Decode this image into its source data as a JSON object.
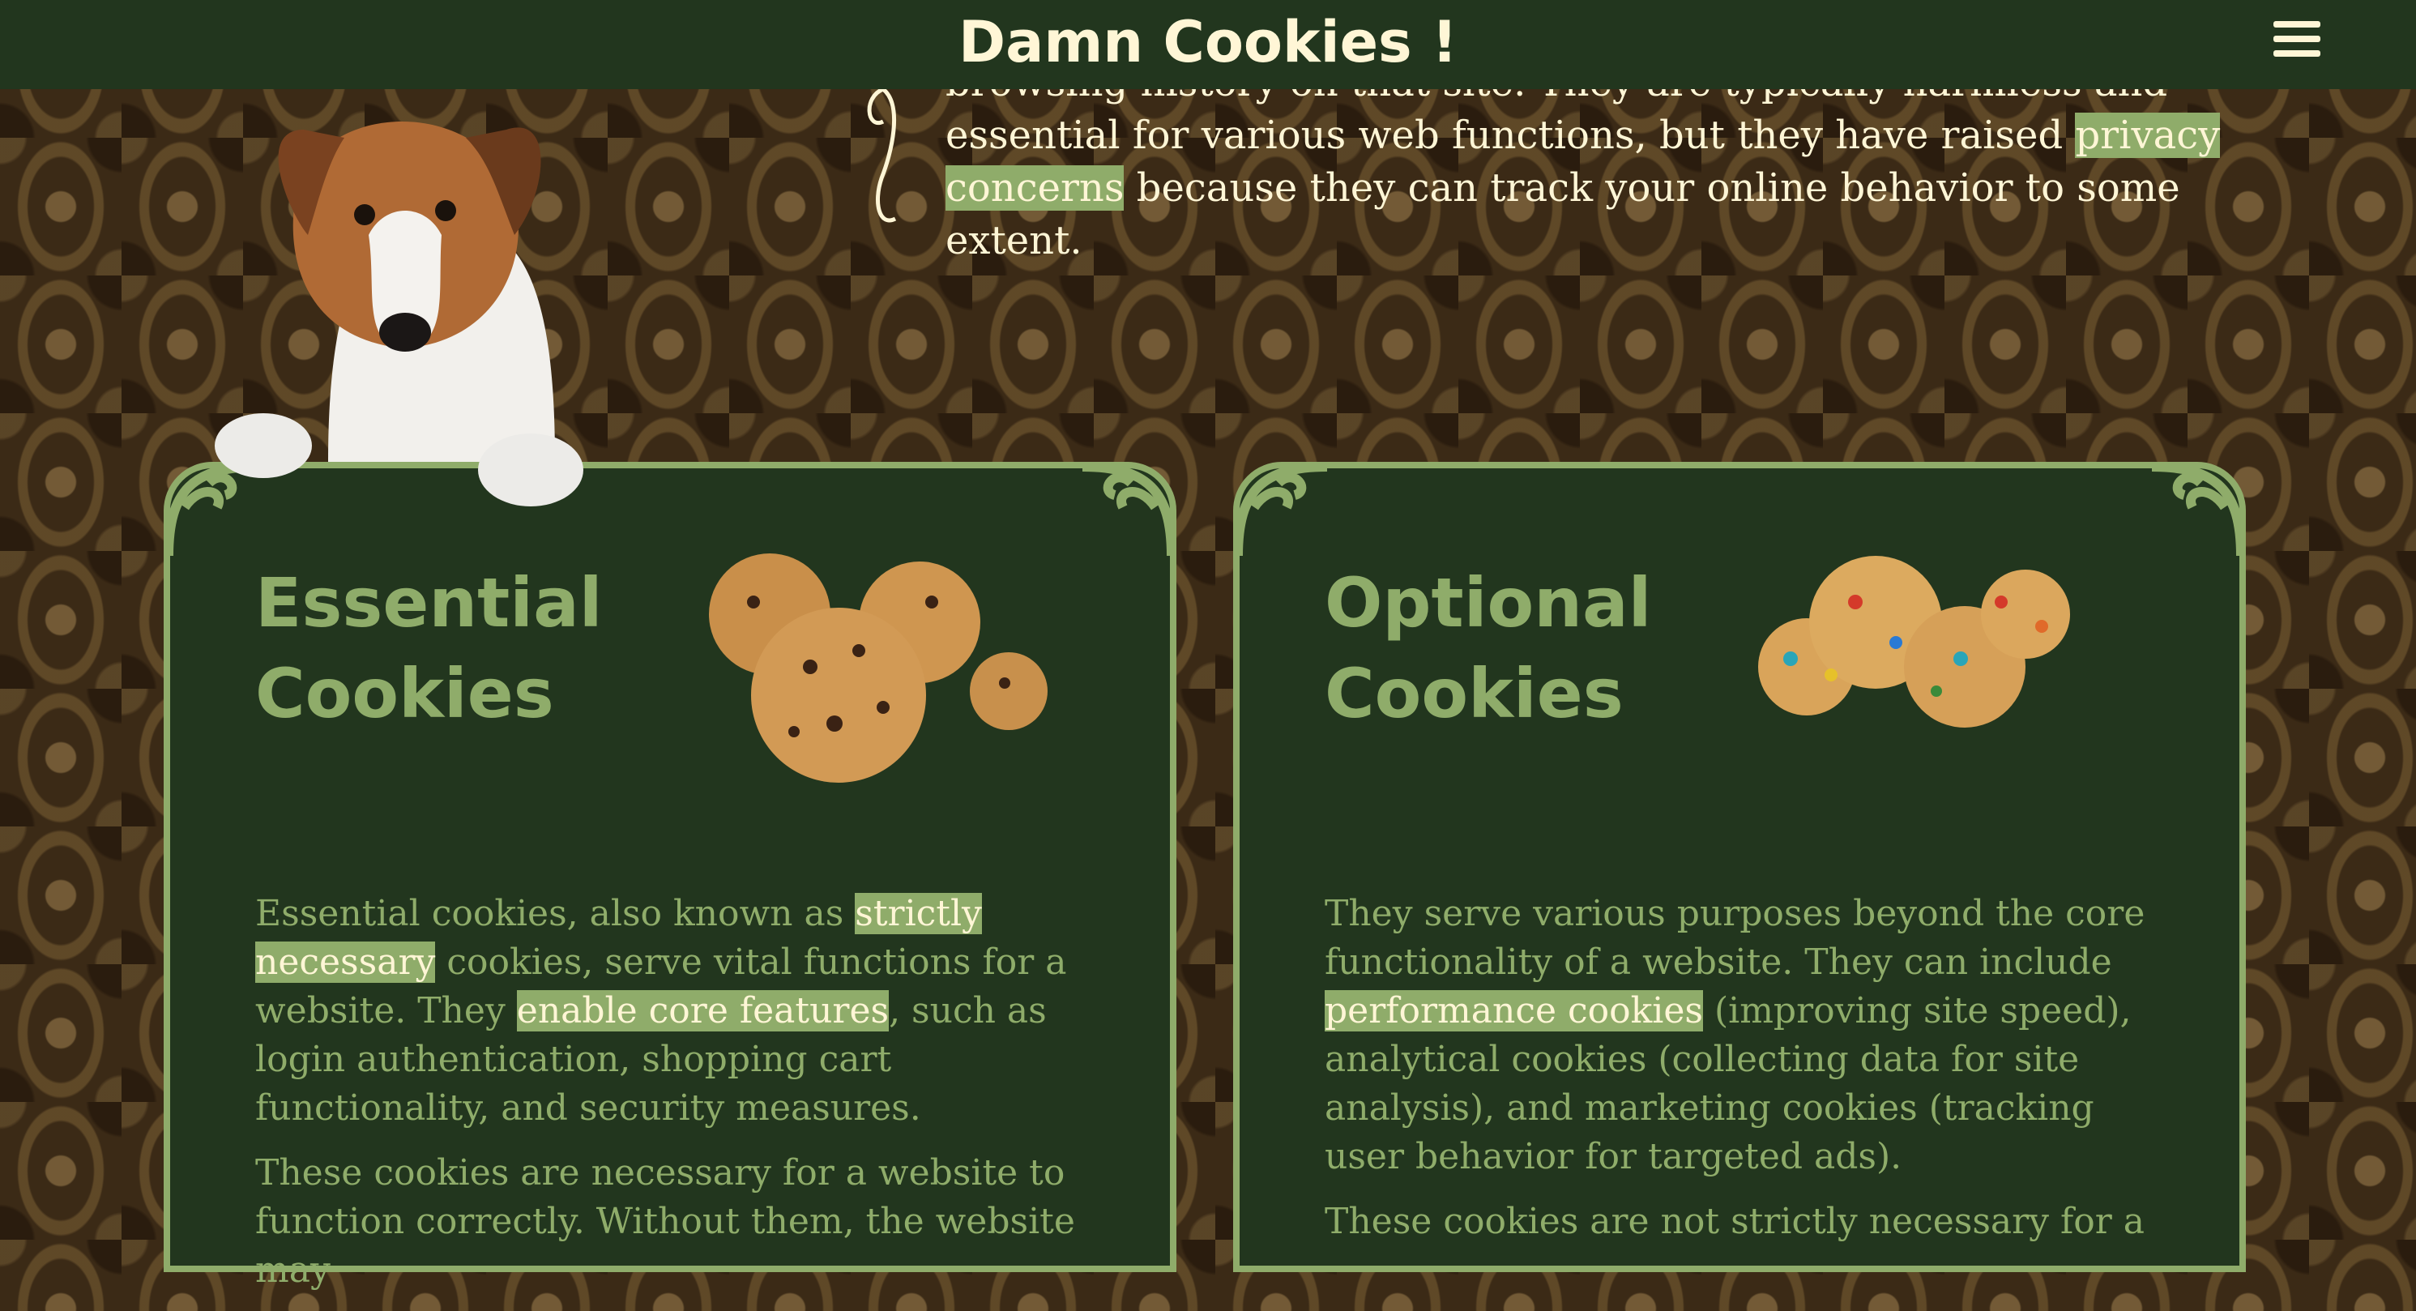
{
  "header": {
    "title": "Damn Cookies !",
    "menu_icon": "hamburger-menu-icon"
  },
  "intro": {
    "line1": "browsing history on that site. They are typically harmless and",
    "text_before": "essential for various web functions, but they have raised ",
    "highlight": "privacy concerns",
    "text_after": " because they can track your online behavior to some extent."
  },
  "cards": [
    {
      "title_line1": "Essential",
      "title_line2": "Cookies",
      "p1": {
        "a": "Essential cookies, also known as ",
        "h1": "strictly necessary",
        "b": " cookies, serve vital functions for a website. They ",
        "h2": "enable core features",
        "c": ", such as login authentication, shopping cart functionality, and security measures."
      },
      "p2": "These cookies are necessary for a website to function correctly. Without them, the website may"
    },
    {
      "title_line1": "Optional",
      "title_line2": "Cookies",
      "p1": {
        "a": "They serve various purposes beyond the core functionality of a website. They can include ",
        "h1": "performance cookies",
        "b": " (improving site speed), analytical cookies (collecting data for site analysis), and marketing cookies (tracking user behavior for targeted ads)."
      },
      "p2": "These cookies are not strictly necessary for a"
    }
  ],
  "colors": {
    "header_bg": "#22361e",
    "title": "#fff6d6",
    "accent": "#8fac6a",
    "card_bg": "#22361e"
  }
}
